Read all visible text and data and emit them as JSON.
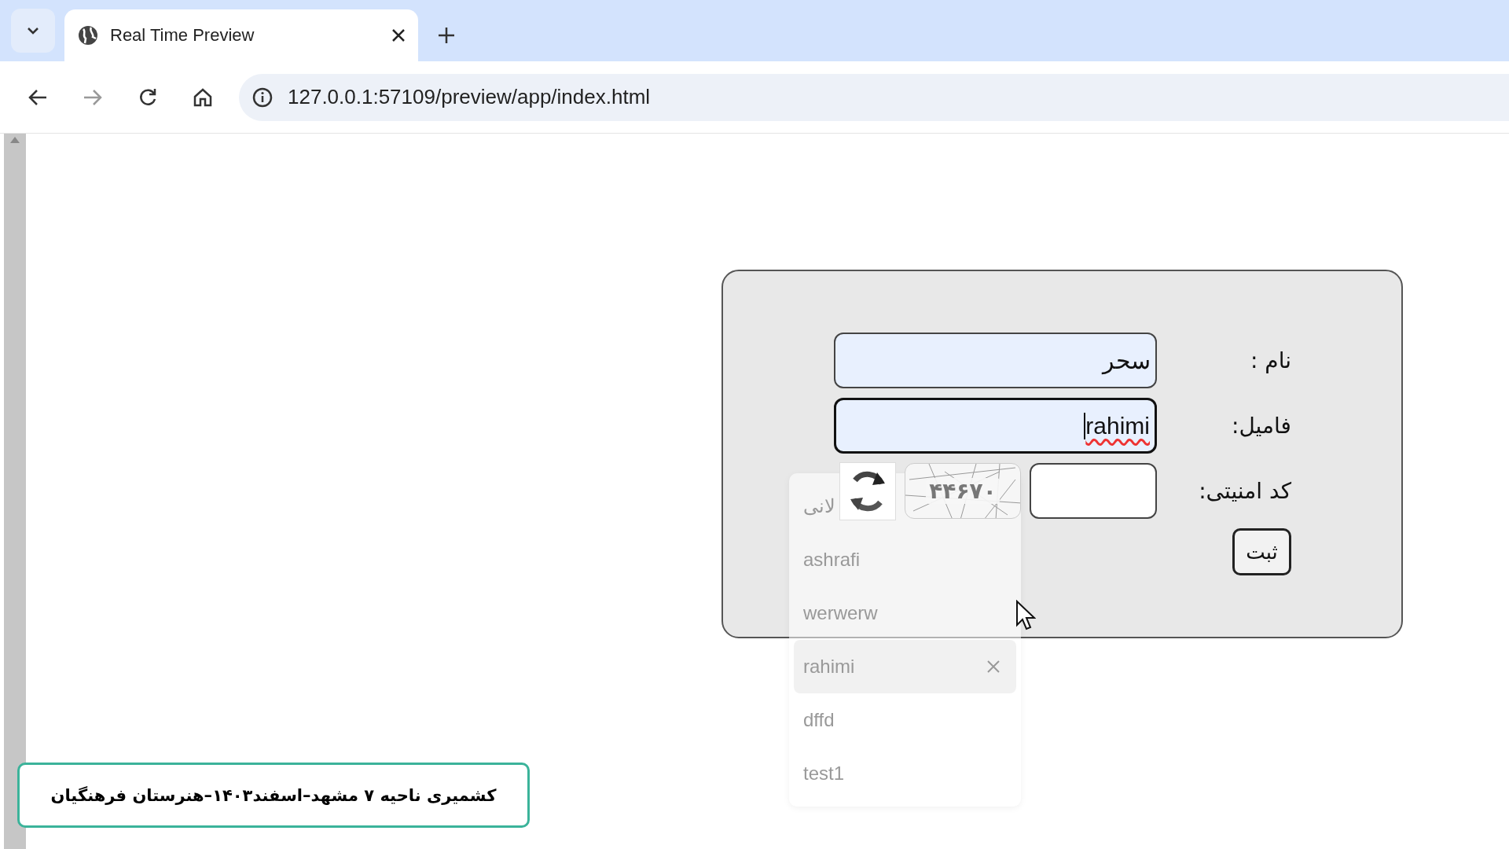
{
  "browser": {
    "tab": {
      "title": "Real Time Preview",
      "selected": true
    },
    "url": "127.0.0.1:57109/preview/app/index.html"
  },
  "form": {
    "fields": [
      {
        "label": "نام :",
        "value": "سحر",
        "focused": false,
        "misspelled": false
      },
      {
        "label": "فامیل:",
        "value": "rahimi",
        "focused": true,
        "misspelled": true
      }
    ],
    "captcha": {
      "label": "کد امنیتی:",
      "code": "۴۴۶۷۰"
    },
    "submit": "ثبت"
  },
  "autocomplete": [
    {
      "text": "لانی",
      "selected": false
    },
    {
      "text": "ashrafi",
      "selected": false
    },
    {
      "text": "werwerw",
      "selected": false
    },
    {
      "text": "rahimi",
      "selected": true
    },
    {
      "text": "dffd",
      "selected": false
    },
    {
      "text": "test1",
      "selected": false
    }
  ],
  "footer": "کشمیری ناحیه ۷ مشهد–اسفند۱۴۰۳–هنرستان فرهنگیان"
}
